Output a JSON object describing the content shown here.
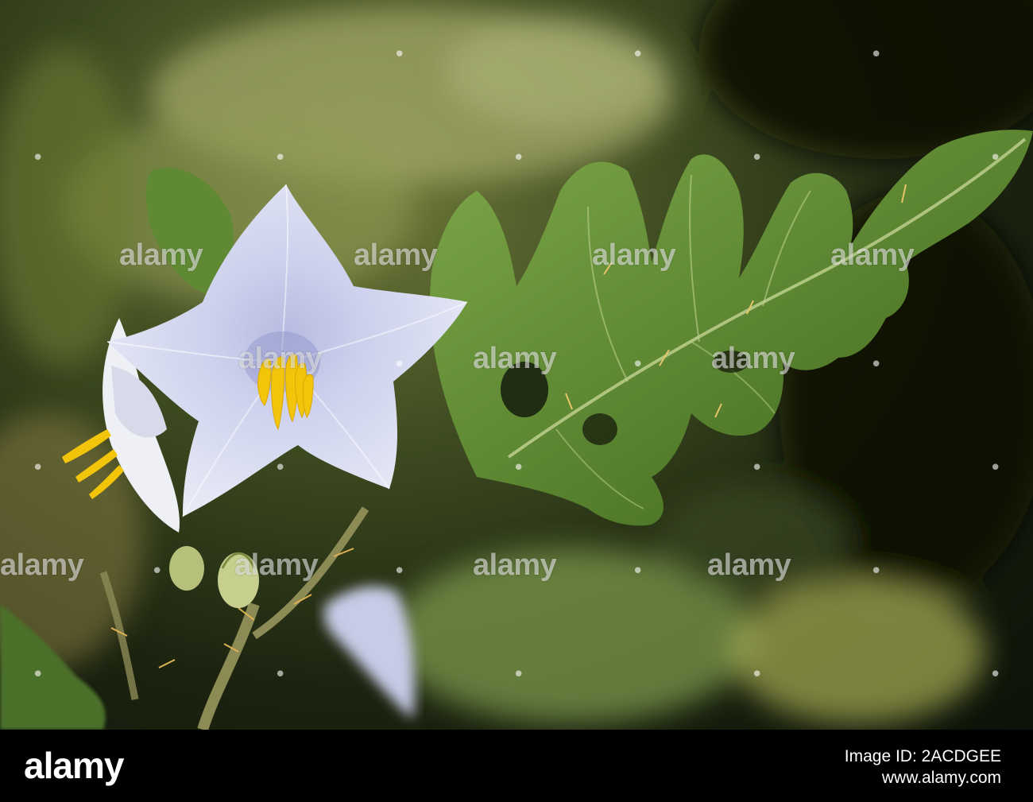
{
  "watermark": {
    "text": "alamy",
    "dot": "•"
  },
  "footer": {
    "logo": "alamy",
    "image_id": "Image ID: 2ACDGEE",
    "site": "www.alamy.com"
  },
  "colors": {
    "petal": "#d6dbee",
    "stamen": "#f2c40a",
    "leaf": "#5e8a34",
    "background": "#1c2410"
  }
}
